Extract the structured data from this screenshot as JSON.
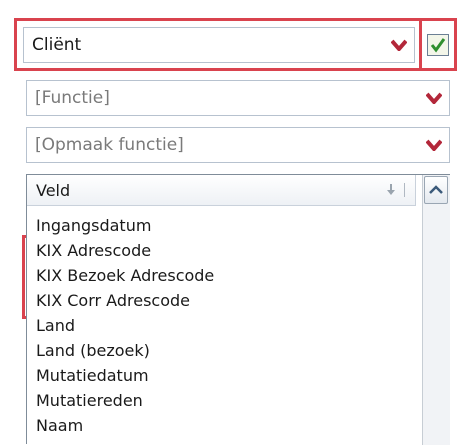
{
  "client_combo": {
    "value": "Cliënt"
  },
  "functie_combo": {
    "placeholder": "[Functie]"
  },
  "opmaak_combo": {
    "placeholder": "[Opmaak functie]"
  },
  "list": {
    "header": "Veld",
    "items": [
      "Ingangsdatum",
      "KIX Adrescode",
      "KIX Bezoek Adrescode",
      "KIX Corr Adrescode",
      "Land",
      "Land (bezoek)",
      "Mutatiedatum",
      "Mutatiereden",
      "Naam"
    ]
  },
  "colors": {
    "highlight": "#d9434e",
    "arrow": "#b3273a",
    "check": "#2f8f2f"
  },
  "icons": [
    "chevron-down-icon",
    "checkmark-icon",
    "sort-arrow-icon",
    "scroll-up-icon"
  ]
}
